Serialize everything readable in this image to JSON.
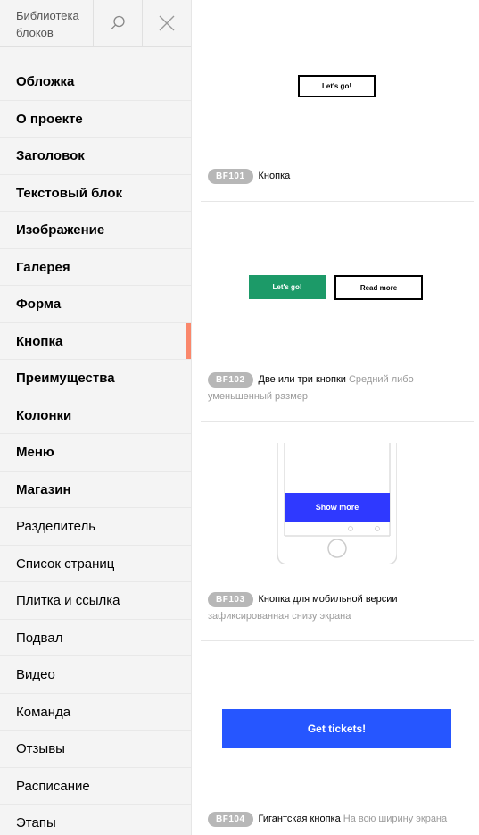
{
  "sidebar": {
    "title": "Библиотека блоков",
    "items": [
      {
        "label": "Обложка",
        "bold": true
      },
      {
        "label": "О проекте",
        "bold": true
      },
      {
        "label": "Заголовок",
        "bold": true
      },
      {
        "label": "Текстовый блок",
        "bold": true
      },
      {
        "label": "Изображение",
        "bold": true
      },
      {
        "label": "Галерея",
        "bold": true
      },
      {
        "label": "Форма",
        "bold": true
      },
      {
        "label": "Кнопка",
        "bold": true,
        "active": true
      },
      {
        "label": "Преимущества",
        "bold": true
      },
      {
        "label": "Колонки",
        "bold": true
      },
      {
        "label": "Меню",
        "bold": true
      },
      {
        "label": "Магазин",
        "bold": true
      },
      {
        "label": "Разделитель",
        "bold": false
      },
      {
        "label": "Список страниц",
        "bold": false
      },
      {
        "label": "Плитка и ссылка",
        "bold": false
      },
      {
        "label": "Подвал",
        "bold": false
      },
      {
        "label": "Видео",
        "bold": false
      },
      {
        "label": "Команда",
        "bold": false
      },
      {
        "label": "Отзывы",
        "bold": false
      },
      {
        "label": "Расписание",
        "bold": false
      },
      {
        "label": "Этапы",
        "bold": false
      }
    ]
  },
  "blocks": [
    {
      "tag": "BF101",
      "name": "Кнопка",
      "desc": "",
      "preview": {
        "btn": "Let's go!"
      }
    },
    {
      "tag": "BF102",
      "name": "Две или три кнопки",
      "desc": "Средний либо уменьшенный размер",
      "preview": {
        "btn1": "Let's go!",
        "btn2": "Read more"
      }
    },
    {
      "tag": "BF103",
      "name": "Кнопка для мобильной версии",
      "desc": "зафиксированная снизу экрана",
      "preview": {
        "btn": "Show more"
      }
    },
    {
      "tag": "BF104",
      "name": "Гигантская кнопка",
      "desc": "На всю ширину экрана",
      "preview": {
        "btn": "Get tickets!"
      }
    }
  ],
  "colors": {
    "accent": "#fa876b",
    "green": "#1c9a68",
    "blue_mobile": "#2f39ff",
    "blue_big": "#2656ff"
  }
}
